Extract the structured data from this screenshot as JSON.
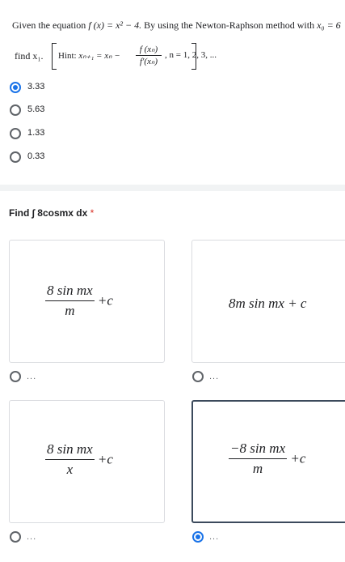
{
  "question1": {
    "lead": "Given the equation",
    "equation": "f (x) = x² − 4.",
    "method": "By using the Newton-Raphson method with",
    "initial": "x₀ = 6",
    "find": "find x₁.",
    "hint_label": "Hint:",
    "hint_lhs": "xₙ₊₁ = xₙ −",
    "hint_num": "f (xₙ)",
    "hint_den": "f′(xₙ)",
    "hint_tail": ", n = 1, 2, 3, ...",
    "options": [
      "3.33",
      "5.63",
      "1.33",
      "0.33"
    ],
    "selected_index": 0
  },
  "question2": {
    "title": "Find ∫ 8cosmx dx",
    "required_mark": "*",
    "options": [
      {
        "numerator": "8 sin mx",
        "denominator": "m",
        "suffix": "+c",
        "label": "..."
      },
      {
        "expression": "8m sin mx + c",
        "label": "..."
      },
      {
        "numerator": "8 sin mx",
        "denominator": "x",
        "suffix": "+c",
        "label": "..."
      },
      {
        "numerator": "−8 sin mx",
        "denominator": "m",
        "suffix": "+c",
        "label": "..."
      }
    ],
    "selected_index": 3
  },
  "colors": {
    "accent": "#1a73e8",
    "required": "#d93025",
    "divider": "#f1f3f4"
  }
}
